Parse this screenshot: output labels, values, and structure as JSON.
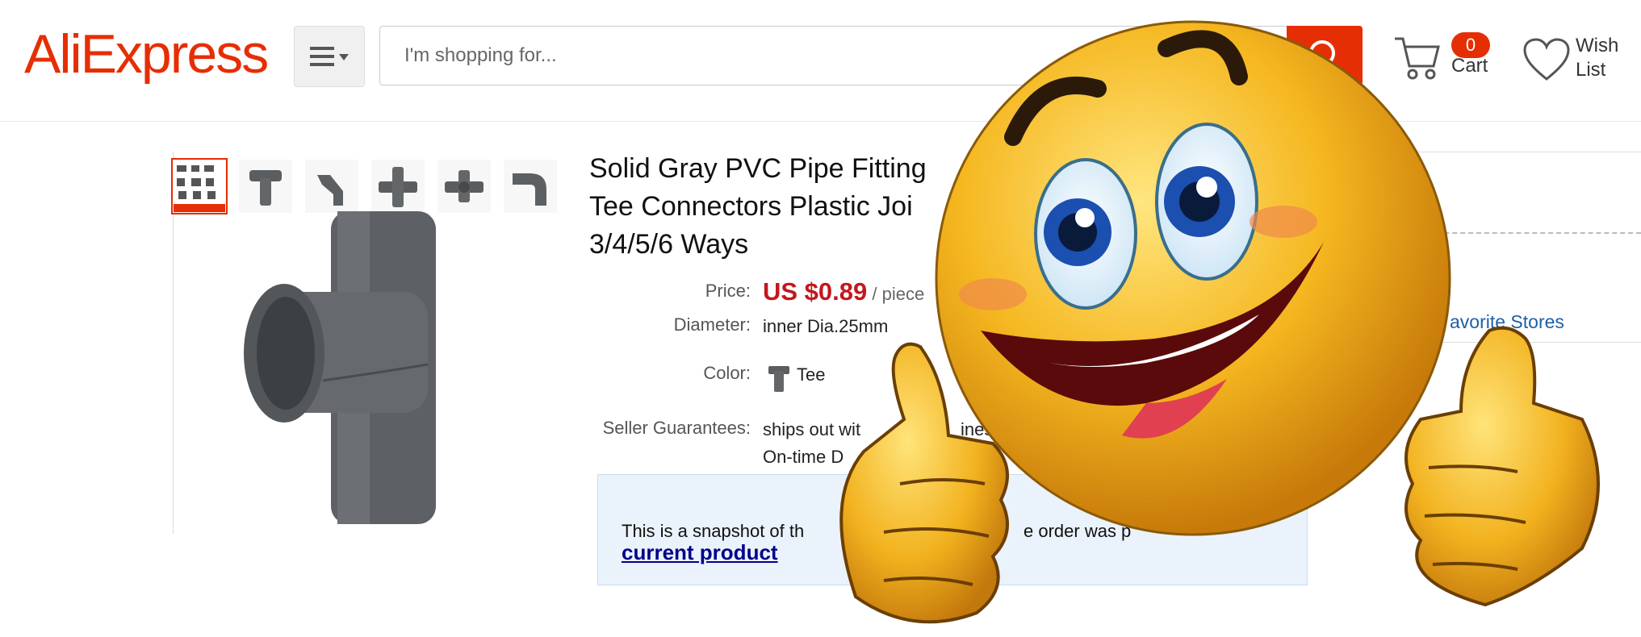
{
  "header": {
    "logo": "AliExpress",
    "search_placeholder": "I'm shopping for...",
    "cart_count": "0",
    "cart_label": "Cart",
    "wish_label_line1": "Wish",
    "wish_label_line2": "List",
    "accent": "#e62e04"
  },
  "product": {
    "title_line1": "Solid Gray PVC Pipe Fitting",
    "title_line2": "Tee Connectors Plastic Joi",
    "title_line3": "3/4/5/6 Ways",
    "price_label": "Price:",
    "price_amount": "US $0.89",
    "price_unit": "/ piece",
    "diameter_label": "Diameter:",
    "diameter_value": "inner Dia.25mm",
    "color_label": "Color:",
    "color_value": "Tee",
    "guarantee_label": "Seller Guarantees:",
    "guarantee_line1": "ships out wit",
    "guarantee_line1_tail": "ines",
    "guarantee_line2": "On-time D"
  },
  "snapshot": {
    "text_left": "This is a snapshot of th",
    "text_right": "e order was p",
    "link": "current product"
  },
  "sidebar": {
    "favorite_stores": "avorite Stores"
  },
  "gallery": {
    "thumbnails": [
      "thumb-collage-icon",
      "thumb-tee-icon",
      "thumb-elbow45-icon",
      "thumb-cross-icon",
      "thumb-4way-icon",
      "thumb-elbow90-icon"
    ]
  },
  "overlay": {
    "icon": "thumbs-up-smiley-icon"
  }
}
